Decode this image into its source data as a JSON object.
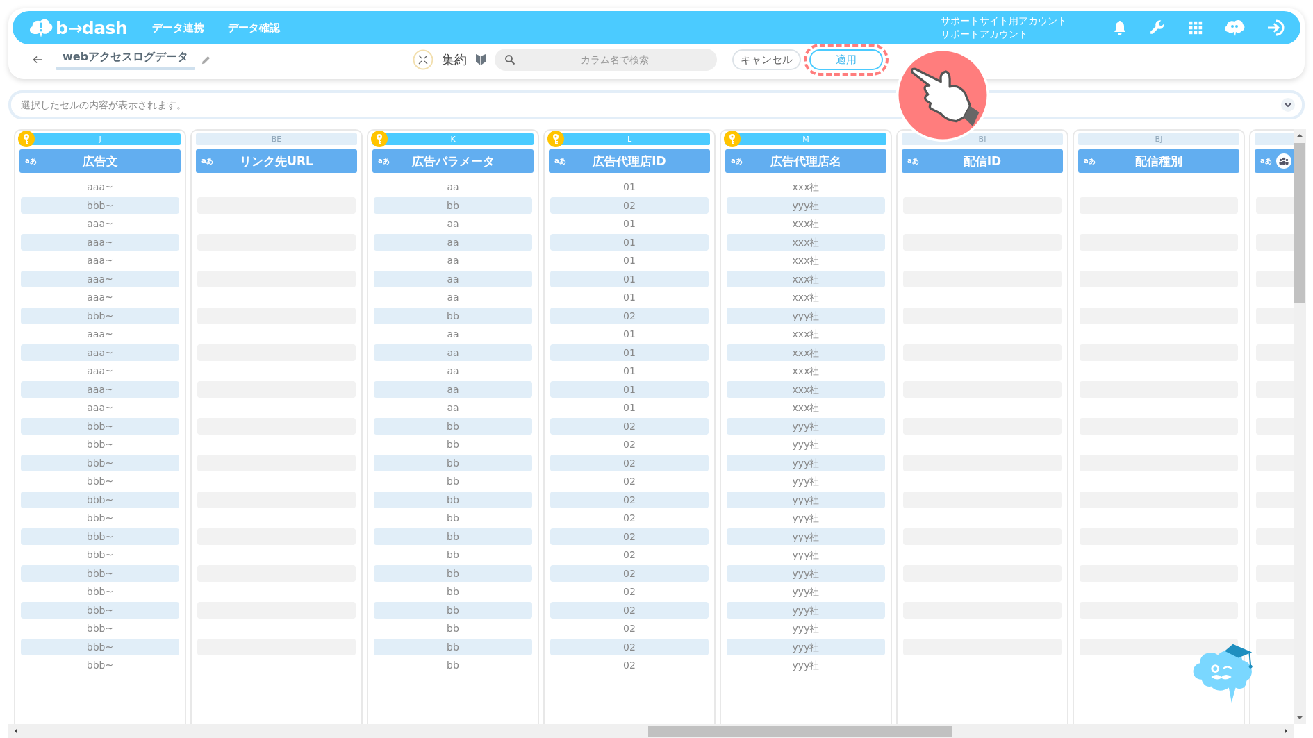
{
  "header": {
    "logo": "b→dash",
    "nav": [
      {
        "label": "データ連携"
      },
      {
        "label": "データ確認"
      }
    ],
    "account": [
      "サポートサイト用アカウント",
      "サポートアカウント"
    ]
  },
  "toolbar": {
    "title": "webアクセスログデータ",
    "aggregate": "集約",
    "search": {
      "placeholder": "カラム名で検索"
    },
    "buttons": [
      {
        "label": "キャンセル",
        "kind": "cancel",
        "highlighted": false
      },
      {
        "label": "適用",
        "kind": "apply",
        "highlighted": true
      }
    ]
  },
  "cell_view": {
    "placeholder": "選択したセルの内容が表示されます。"
  },
  "columns": [
    {
      "kind": "text",
      "letter": "J",
      "key": true,
      "type": "aあ",
      "name": "広告文",
      "values": [
        "aaa~",
        "bbb~",
        "aaa~",
        "aaa~",
        "aaa~",
        "aaa~",
        "aaa~",
        "bbb~",
        "aaa~",
        "aaa~",
        "aaa~",
        "aaa~",
        "aaa~",
        "bbb~",
        "bbb~",
        "bbb~",
        "bbb~",
        "bbb~",
        "bbb~",
        "bbb~",
        "bbb~",
        "bbb~",
        "bbb~",
        "bbb~",
        "bbb~",
        "bbb~",
        "bbb~"
      ]
    },
    {
      "kind": "text",
      "letter": "BE",
      "key": false,
      "type": "aあ",
      "name": "リンク先URL"
    },
    {
      "kind": "text",
      "letter": "K",
      "key": true,
      "type": "aあ",
      "name": "広告パラメータ",
      "values": [
        "aa",
        "bb",
        "aa",
        "aa",
        "aa",
        "aa",
        "aa",
        "bb",
        "aa",
        "aa",
        "aa",
        "aa",
        "aa",
        "bb",
        "bb",
        "bb",
        "bb",
        "bb",
        "bb",
        "bb",
        "bb",
        "bb",
        "bb",
        "bb",
        "bb",
        "bb",
        "bb"
      ]
    },
    {
      "kind": "text",
      "letter": "L",
      "key": true,
      "type": "aあ",
      "name": "広告代理店ID",
      "values": [
        "01",
        "02",
        "01",
        "01",
        "01",
        "01",
        "01",
        "02",
        "01",
        "01",
        "01",
        "01",
        "01",
        "02",
        "02",
        "02",
        "02",
        "02",
        "02",
        "02",
        "02",
        "02",
        "02",
        "02",
        "02",
        "02",
        "02"
      ]
    },
    {
      "kind": "text",
      "letter": "M",
      "key": true,
      "type": "aあ",
      "name": "広告代理店名",
      "values": [
        "xxx社",
        "yyy社",
        "xxx社",
        "xxx社",
        "xxx社",
        "xxx社",
        "xxx社",
        "yyy社",
        "xxx社",
        "xxx社",
        "xxx社",
        "xxx社",
        "xxx社",
        "yyy社",
        "yyy社",
        "yyy社",
        "yyy社",
        "yyy社",
        "yyy社",
        "yyy社",
        "yyy社",
        "yyy社",
        "yyy社",
        "yyy社",
        "yyy社",
        "yyy社",
        "yyy社"
      ]
    },
    {
      "kind": "text",
      "letter": "BI",
      "key": false,
      "type": "aあ",
      "name": "配信ID"
    },
    {
      "kind": "text",
      "letter": "BJ",
      "key": false,
      "type": "aあ",
      "name": "配信種別"
    },
    {
      "kind": "group",
      "key": false,
      "type": "aあ"
    }
  ]
}
